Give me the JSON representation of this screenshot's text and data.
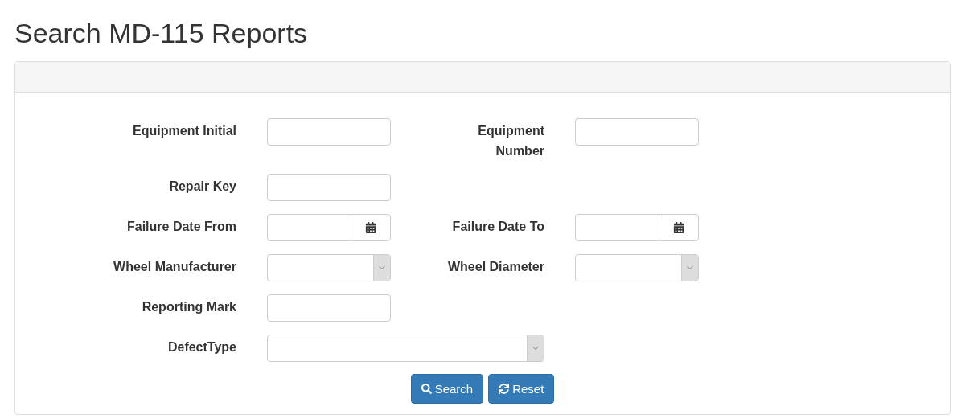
{
  "title": "Search MD-115 Reports",
  "rows": [
    {
      "fields": [
        {
          "label": "Equipment Initial",
          "kind": "text"
        },
        {
          "label": "Equipment Number",
          "kind": "text"
        }
      ]
    },
    {
      "fields": [
        {
          "label": "Repair Key",
          "kind": "text"
        }
      ]
    },
    {
      "fields": [
        {
          "label": "Failure Date From",
          "kind": "date"
        },
        {
          "label": "Failure Date To",
          "kind": "date"
        }
      ]
    },
    {
      "fields": [
        {
          "label": "Wheel Manufacturer",
          "kind": "select"
        },
        {
          "label": "Wheel Diameter",
          "kind": "select"
        }
      ]
    },
    {
      "fields": [
        {
          "label": "Reporting Mark",
          "kind": "text"
        }
      ]
    },
    {
      "fields": [
        {
          "label": "DefectType",
          "kind": "wide-select"
        }
      ]
    }
  ],
  "buttons": [
    {
      "label": "Search",
      "kind": "search"
    },
    {
      "label": "Reset",
      "kind": "reset"
    }
  ]
}
